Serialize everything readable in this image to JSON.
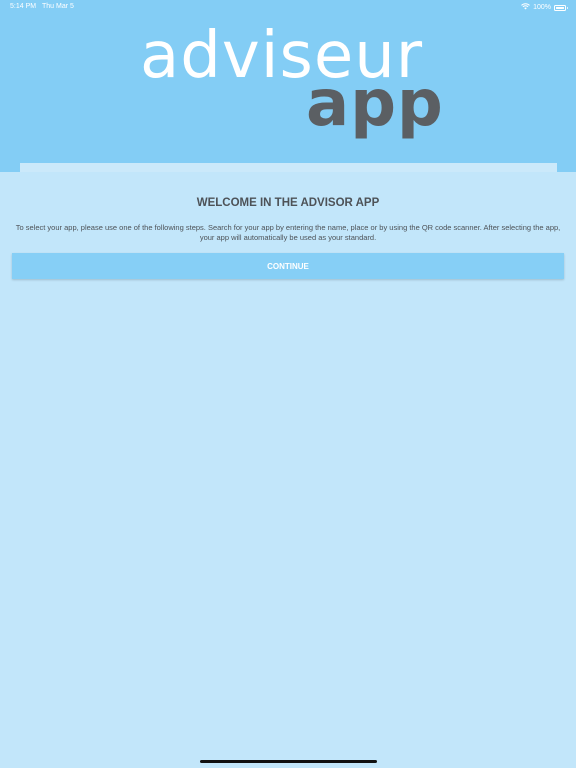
{
  "status_bar": {
    "time": "5:14 PM",
    "date": "Thu Mar 5",
    "battery": "100%",
    "wifi_icon": "wifi-icon",
    "battery_icon": "battery-icon"
  },
  "logo": {
    "top": "adviseur",
    "bottom": "app"
  },
  "welcome": {
    "title": "WELCOME IN THE ADVISOR APP",
    "text": "To select your app, please use one of the following steps. Search for your app by entering the name, place or by using the QR code scanner. After selecting the app, your app will automatically be used as your standard."
  },
  "continue_label": "CONTINUE",
  "colors": {
    "header": "#83cdf5",
    "background": "#c2e6fa",
    "button": "#86cff6",
    "logo_white": "#ffffff",
    "logo_gray": "#5b5f63"
  }
}
